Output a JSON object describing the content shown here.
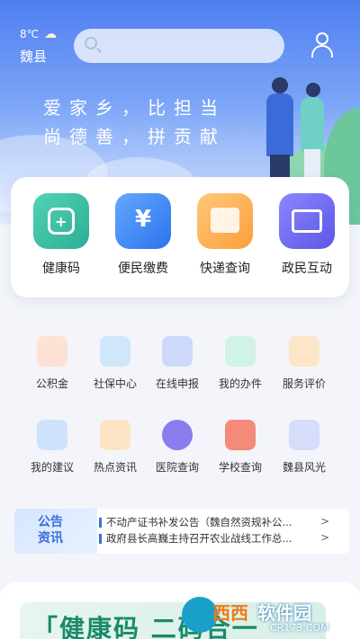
{
  "header": {
    "temperature": "8℃",
    "city": "魏县",
    "search_placeholder": ""
  },
  "banner": {
    "slogan_line1": "爱家乡，比担当",
    "slogan_line2": "尚德善，拼贡献"
  },
  "main_services": [
    {
      "label": "健康码",
      "icon": "health-code-icon",
      "color": "#2cae95"
    },
    {
      "label": "便民缴费",
      "icon": "payment-icon",
      "color": "#2d72ec"
    },
    {
      "label": "快递查询",
      "icon": "package-icon",
      "color": "#fb9f3a"
    },
    {
      "label": "政民互动",
      "icon": "mail-icon",
      "color": "#5b56e6"
    }
  ],
  "services_row1": [
    {
      "label": "公积金",
      "icon": "house-fund-icon"
    },
    {
      "label": "社保中心",
      "icon": "social-security-icon"
    },
    {
      "label": "在线申报",
      "icon": "upload-icon"
    },
    {
      "label": "我的办件",
      "icon": "person-card-icon"
    },
    {
      "label": "服务评价",
      "icon": "review-icon"
    }
  ],
  "services_row2": [
    {
      "label": "我的建议",
      "icon": "chat-icon"
    },
    {
      "label": "热点资讯",
      "icon": "news-icon"
    },
    {
      "label": "医院查询",
      "icon": "hospital-icon"
    },
    {
      "label": "学校查询",
      "icon": "school-icon"
    },
    {
      "label": "魏县风光",
      "icon": "scenery-icon"
    }
  ],
  "notice": {
    "badge": "公告资讯",
    "items": [
      "不动产证书补发公告（魏自然资规补公...",
      "政府县长高巍主持召开农业战线工作总..."
    ],
    "arrow": ">"
  },
  "bottom_banner": {
    "text": "「健康码 二码合一"
  },
  "watermark": {
    "brand": "西西",
    "name": "软件园",
    "url": "CR173.COM"
  }
}
